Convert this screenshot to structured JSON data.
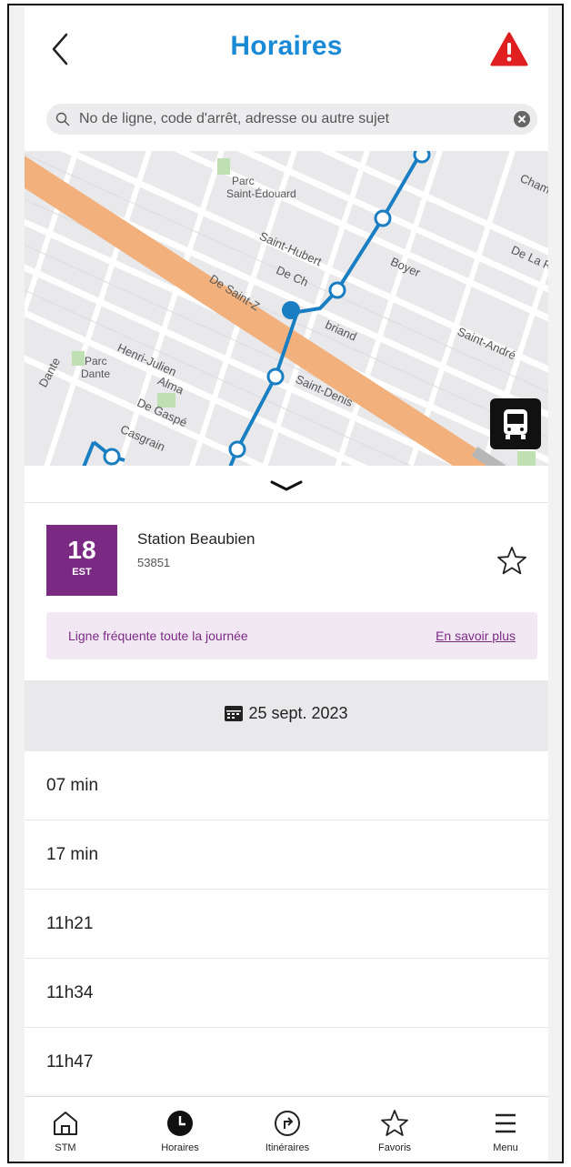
{
  "header": {
    "title": "Horaires"
  },
  "search": {
    "placeholder": "No de ligne, code d'arrêt, adresse ou autre sujet"
  },
  "map": {
    "labels": {
      "parc_st_edouard_1": "Parc",
      "parc_st_edouard_2": "Saint-Édouard",
      "chambord": "Chamb",
      "saint_hubert": "Saint-Hubert",
      "boyer": "Boyer",
      "de_la_roche": "De La R",
      "de_chateaubriand_1": "De Ch",
      "de_chateaubriand_2": "briand",
      "de_saint_zotique": "De Saint-Z",
      "saint_andre": "Saint-André",
      "henri_julien": "Henri-Julien",
      "parc_dante_1": "Parc",
      "parc_dante_2": "Dante",
      "dante": "Dante",
      "alma": "Alma",
      "de_gaspe": "De Gaspé",
      "saint_denis": "Saint-Denis",
      "casgrain": "Casgrain"
    }
  },
  "stop": {
    "route_number": "18",
    "route_direction": "EST",
    "name": "Station Beaubien",
    "code": "53851",
    "frequency_text": "Ligne fréquente toute la journée",
    "frequency_link": "En savoir plus"
  },
  "date": {
    "label": "25 sept. 2023"
  },
  "times": [
    "07 min",
    "17 min",
    "11h21",
    "11h34",
    "11h47"
  ],
  "nav": {
    "stm": "STM",
    "horaires": "Horaires",
    "itineraires": "Itinéraires",
    "favoris": "Favoris",
    "menu": "Menu"
  },
  "colors": {
    "accent_blue": "#1a8ad6",
    "route_purple": "#7b2a84",
    "frequency_bg": "#f2e8f3",
    "alert_red": "#e02020",
    "line_blue": "#1a7ec2",
    "arterial_orange": "#f2b17c"
  }
}
